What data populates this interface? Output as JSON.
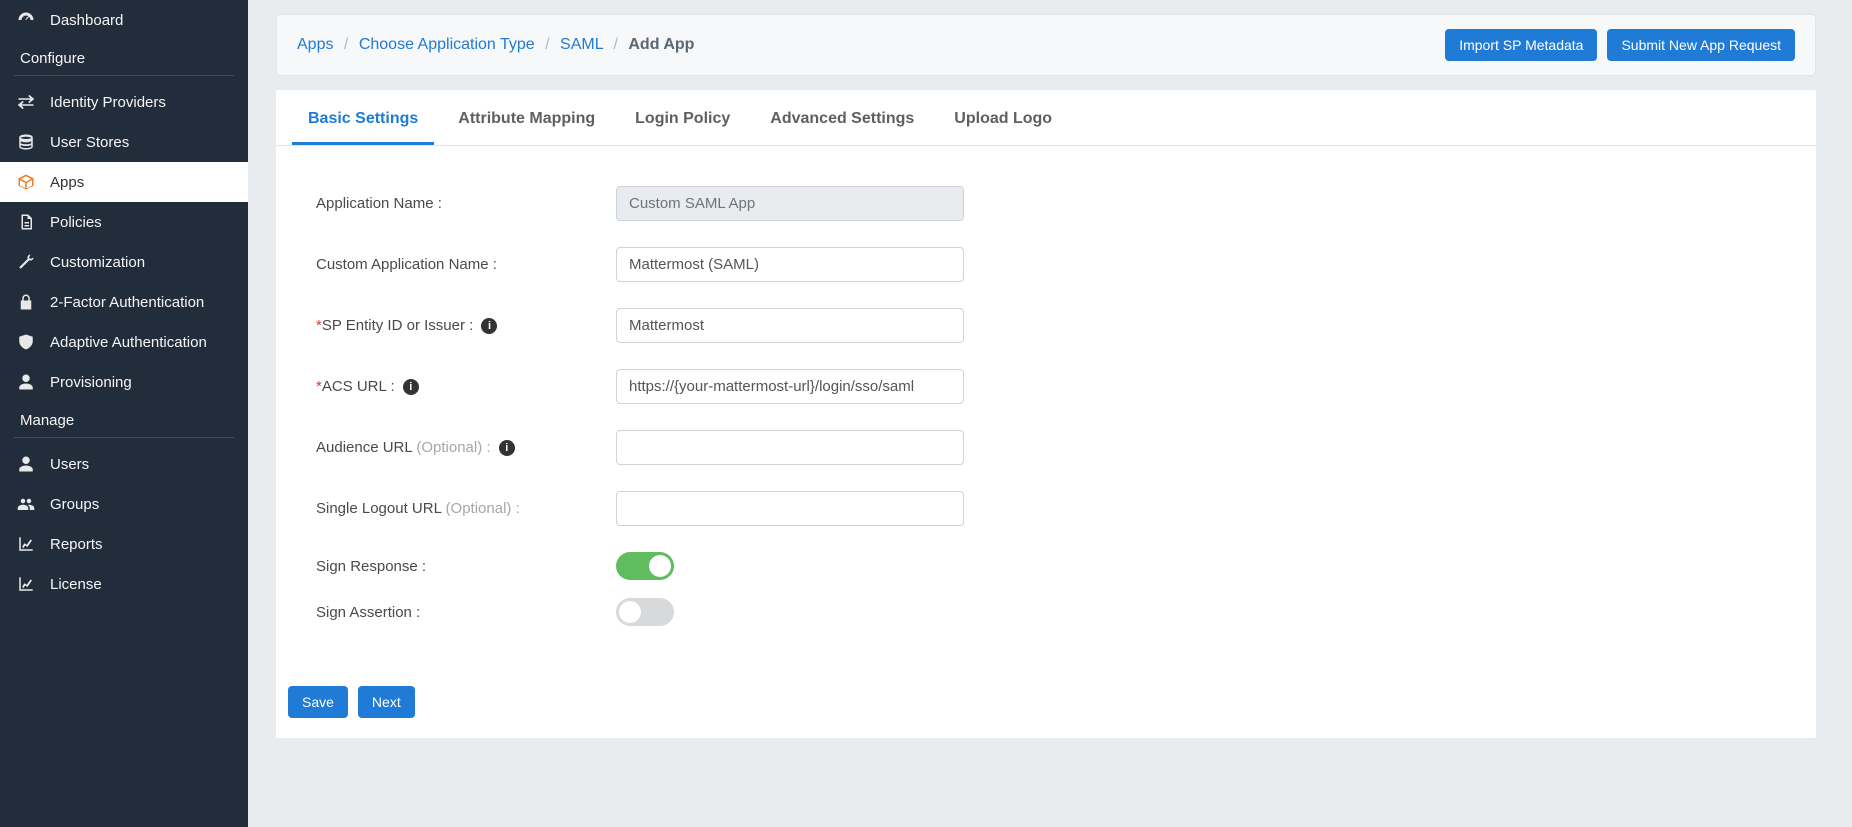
{
  "sidebar": {
    "dashboard": "Dashboard",
    "section_configure": "Configure",
    "identity_providers": "Identity Providers",
    "user_stores": "User Stores",
    "apps": "Apps",
    "policies": "Policies",
    "customization": "Customization",
    "two_factor_auth": "2-Factor Authentication",
    "adaptive_auth": "Adaptive Authentication",
    "provisioning": "Provisioning",
    "section_manage": "Manage",
    "users": "Users",
    "groups": "Groups",
    "reports": "Reports",
    "license": "License"
  },
  "breadcrumb": {
    "apps": "Apps",
    "choose_type": "Choose Application Type",
    "saml": "SAML",
    "add_app": "Add App"
  },
  "header_buttons": {
    "import": "Import SP Metadata",
    "submit": "Submit New App Request"
  },
  "tabs": {
    "basic": "Basic Settings",
    "attribute": "Attribute Mapping",
    "login": "Login Policy",
    "advanced": "Advanced Settings",
    "upload": "Upload Logo"
  },
  "form": {
    "app_name_label": "Application Name :",
    "app_name_value": "Custom SAML App",
    "custom_app_name_label": "Custom Application Name :",
    "custom_app_name_value": "Mattermost (SAML)",
    "sp_entity_label": "SP Entity ID or Issuer :",
    "sp_entity_value": "Mattermost",
    "acs_url_label": "ACS URL :",
    "acs_url_value": "https://{your-mattermost-url}/login/sso/saml",
    "audience_url_label": "Audience URL",
    "audience_url_optional": "(Optional) :",
    "single_logout_label": "Single Logout URL",
    "single_logout_optional": "(Optional) :",
    "sign_response_label": "Sign Response :",
    "sign_assertion_label": "Sign Assertion :"
  },
  "footer": {
    "save": "Save",
    "next": "Next"
  }
}
